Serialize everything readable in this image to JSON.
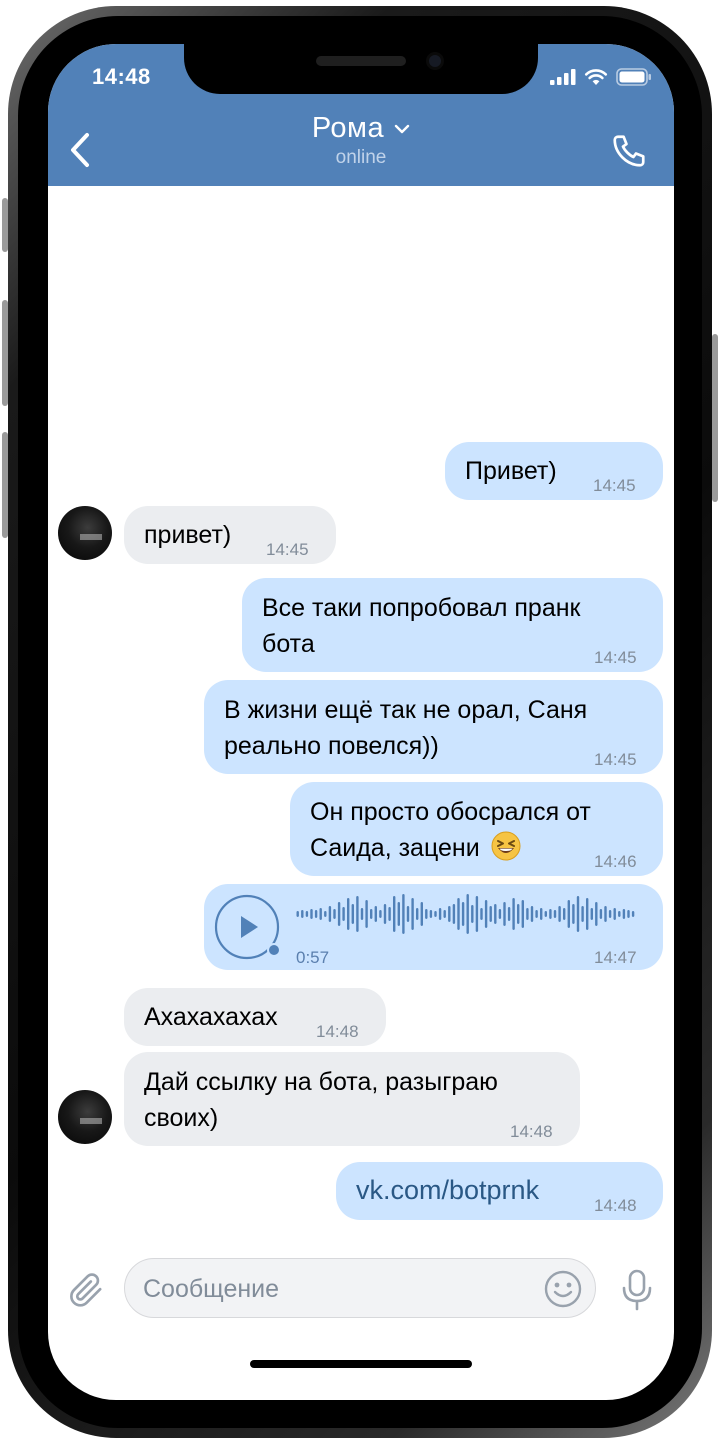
{
  "status_bar": {
    "time": "14:48"
  },
  "header": {
    "contact_name": "Рома",
    "contact_status": "online"
  },
  "messages": [
    {
      "direction": "out",
      "text": "Привет)",
      "time": "14:45"
    },
    {
      "direction": "in",
      "text": "привет)",
      "time": "14:45"
    },
    {
      "direction": "out",
      "lines": [
        "Все таки попробовал пранк",
        "бота"
      ],
      "time": "14:45"
    },
    {
      "direction": "out",
      "lines": [
        "В жизни ещё так не орал, Саня",
        "реально повелся))"
      ],
      "time": "14:45"
    },
    {
      "direction": "out",
      "lines": [
        "Он просто обосрался от",
        "Саида, зацени"
      ],
      "emoji": "grinning-squinting-face",
      "time": "14:46"
    },
    {
      "direction": "out",
      "type": "voice",
      "duration": "0:57",
      "time": "14:47"
    },
    {
      "direction": "in",
      "text": "Ахахахахах",
      "time": "14:48"
    },
    {
      "direction": "in",
      "lines": [
        "Дай ссылку на бота, разыграю",
        "своих)"
      ],
      "time": "14:48"
    },
    {
      "direction": "out",
      "text": "vk.com/botprnk",
      "time": "14:48",
      "is_link": true
    }
  ],
  "composer": {
    "placeholder": "Сообщение"
  },
  "colors": {
    "header": "#5181b8",
    "outgoing_bubble": "#cce4ff",
    "incoming_bubble": "#ebedf0",
    "timestamp": "#818c99",
    "link": "#2a5885"
  }
}
